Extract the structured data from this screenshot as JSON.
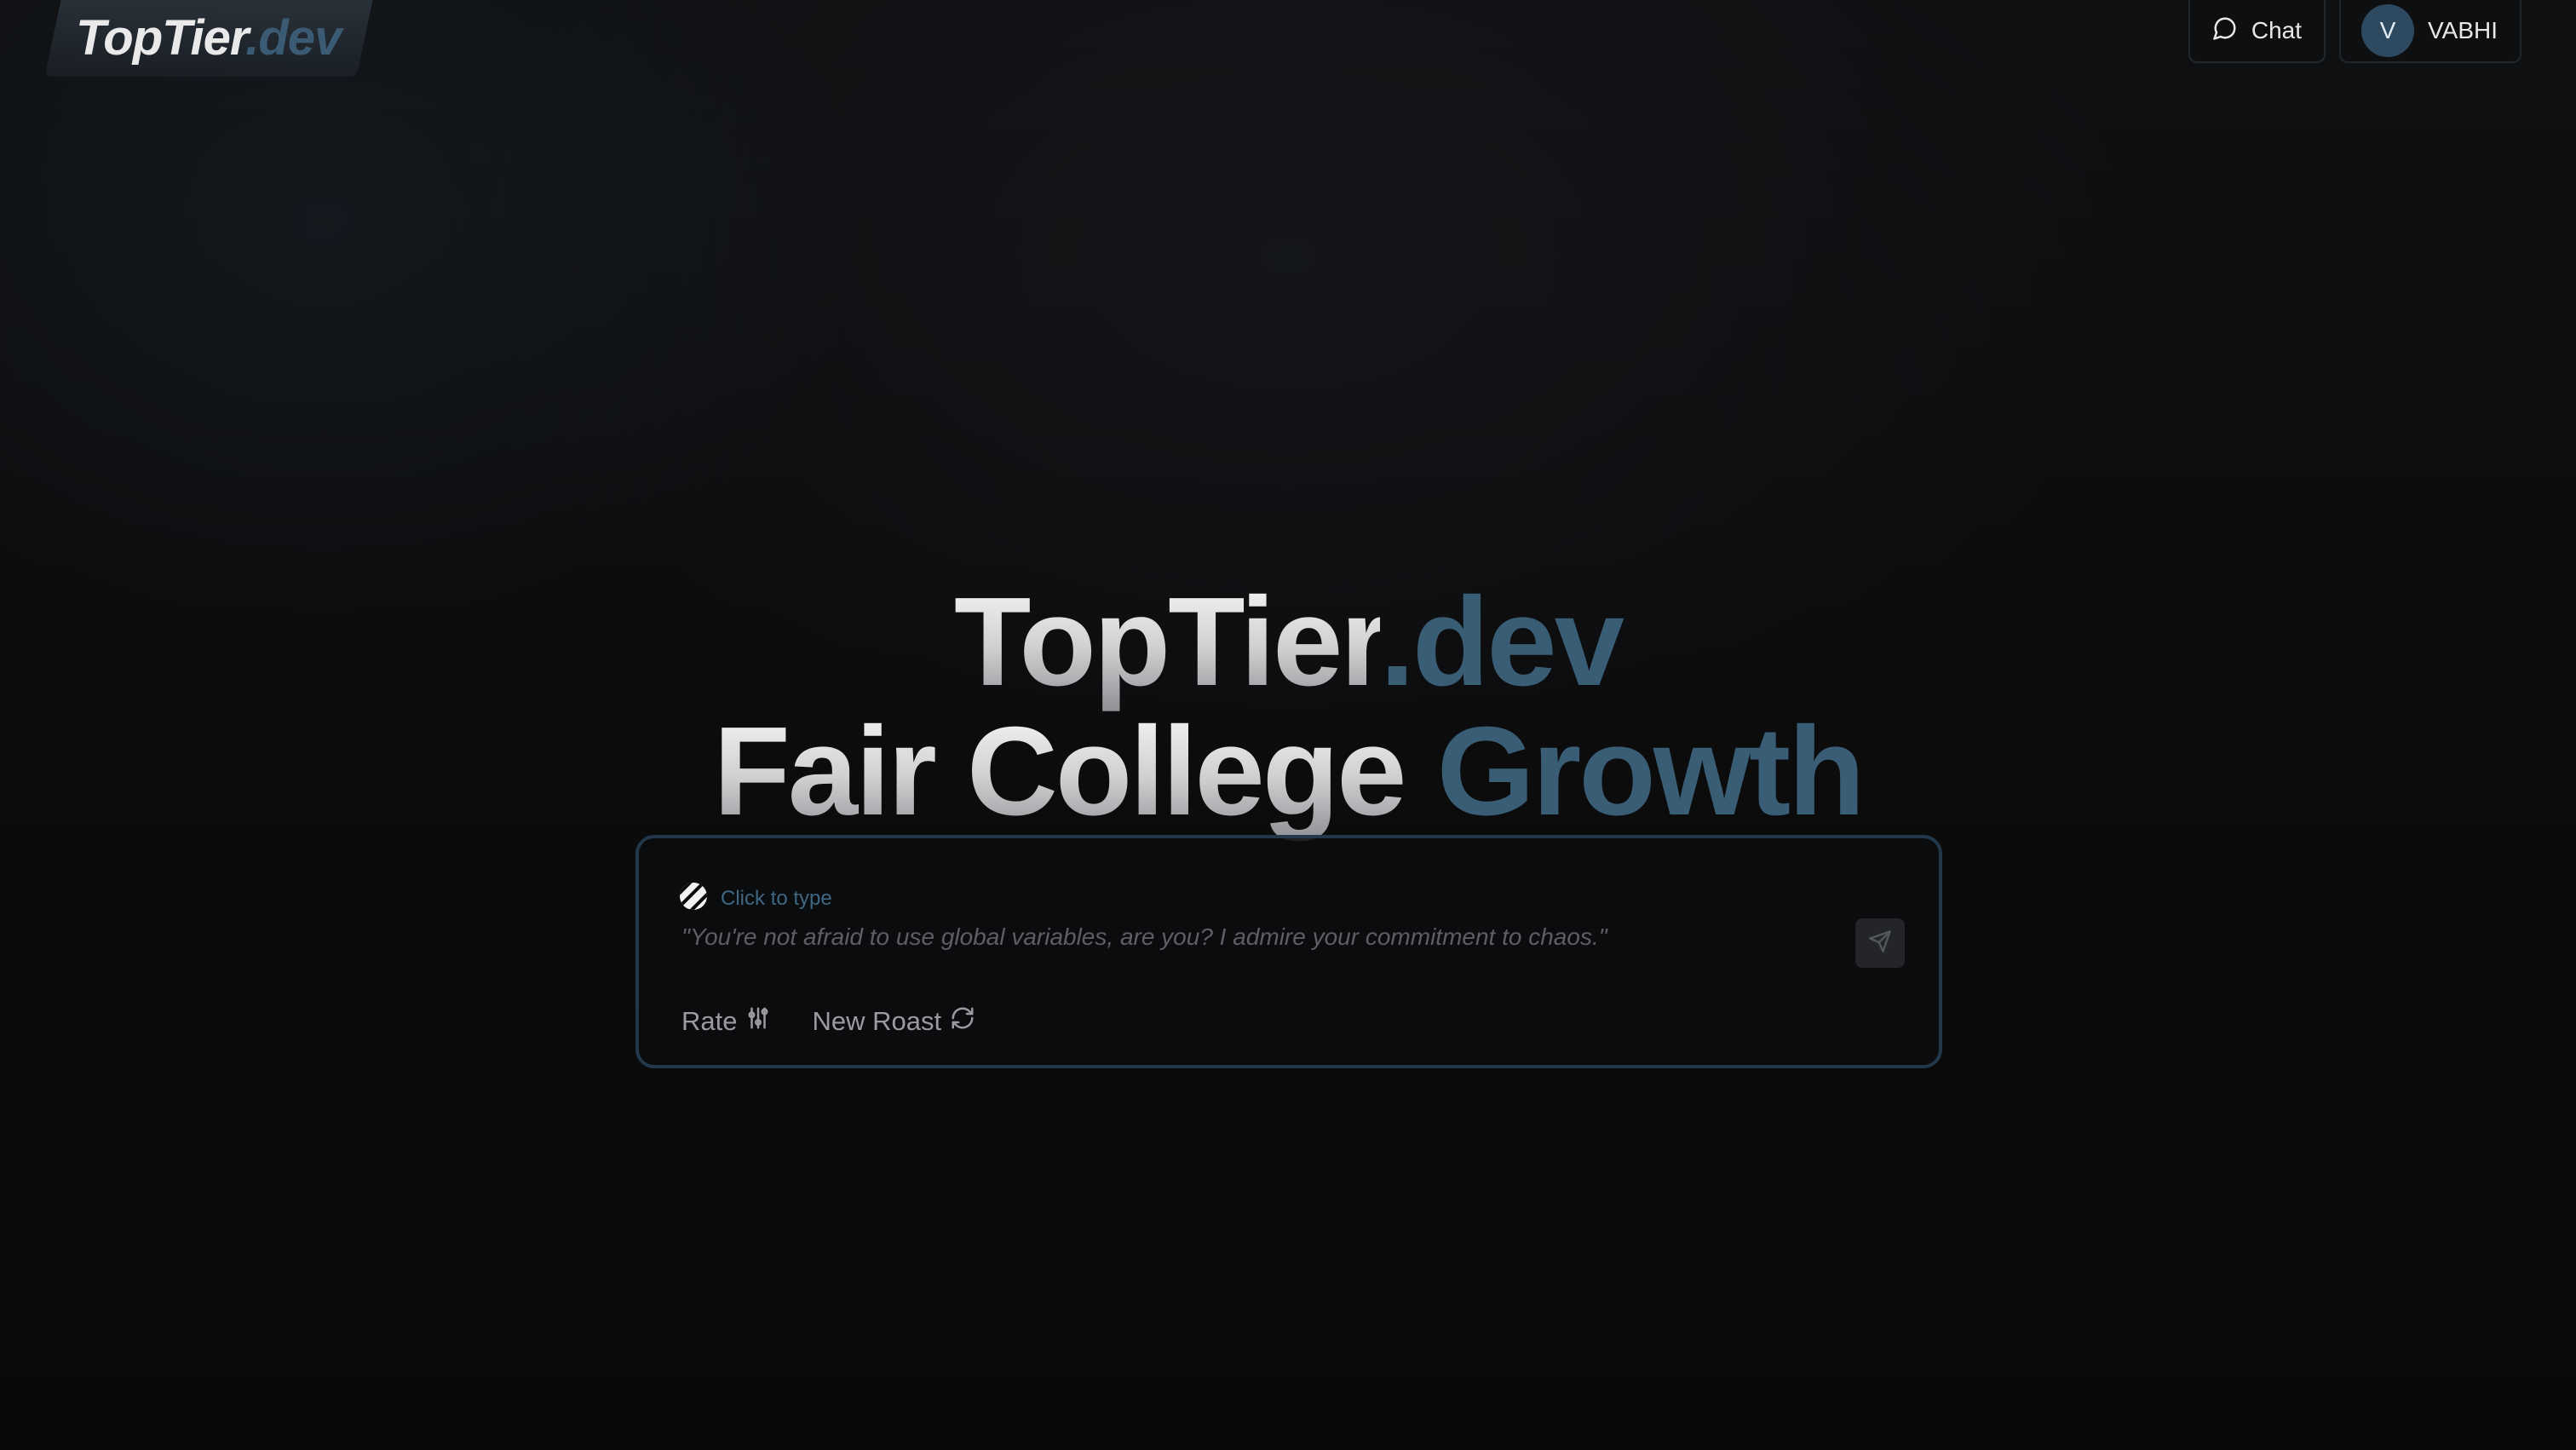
{
  "logo": {
    "part1": "TopTier",
    "part2": ".dev"
  },
  "header": {
    "chat_label": "Chat",
    "user": {
      "initial": "V",
      "name": "VABHI"
    }
  },
  "hero": {
    "line1_a": "TopTier",
    "line1_b": ".dev",
    "line2_a": "Fair College",
    "line2_b": "Growth"
  },
  "input_card": {
    "hint": "Click to type",
    "quote": "\"You're not afraid to use global variables, are you? I admire your commitment to chaos.\"",
    "actions": {
      "rate_label": "Rate",
      "new_roast_label": "New Roast"
    }
  },
  "colors": {
    "accent": "#3a5d76",
    "background": "#0a0a0b",
    "card_border": "#22384a"
  },
  "icons": [
    "chat-bubble-icon",
    "edit-pattern-icon",
    "send-icon",
    "sliders-icon",
    "refresh-icon"
  ]
}
